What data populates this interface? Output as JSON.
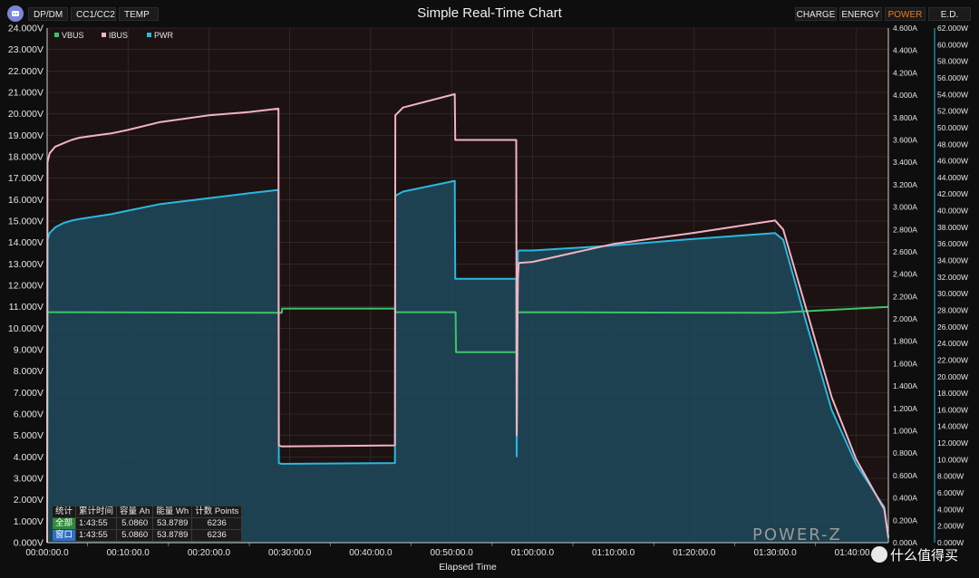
{
  "app": {
    "title": "Simple Real-Time Chart",
    "left_tabs": [
      "DP/DM",
      "CC1/CC2",
      "TEMP"
    ],
    "right_tabs": [
      "CHARGE",
      "ENERGY",
      "POWER",
      "E.D."
    ],
    "active_right_tab": "POWER",
    "watermark": "POWER-Z",
    "brand": "什么值得买"
  },
  "stats_table": {
    "headers": [
      "统计",
      "累计时间",
      "容量 Ah",
      "能量 Wh",
      "计数 Points"
    ],
    "rows": [
      [
        "全部",
        "1:43:55",
        "5.0860",
        "53.8789",
        "6236"
      ],
      [
        "窗口",
        "1:43:55",
        "5.0860",
        "53.8789",
        "6236"
      ]
    ]
  },
  "colors": {
    "vbus": "#3cc46a",
    "ibus": "#f2b3c3",
    "pwr": "#2ab8df",
    "pwr_fill": "#1d4a5c",
    "background": "#1c1212",
    "active_tab": "#f07a1e"
  },
  "chart_data": {
    "type": "line",
    "title": "Simple Real-Time Chart",
    "xlabel": "Elapsed Time",
    "x_unit": "minutes",
    "xlim": [
      0,
      104
    ],
    "x_ticks": [
      "00:00:00.0",
      "00:10:00.0",
      "00:20:00.0",
      "00:30:00.0",
      "00:40:00.0",
      "00:50:00.0",
      "01:00:00.0",
      "01:10:00.0",
      "01:20:00.0",
      "01:30:00.0",
      "01:40:00.0"
    ],
    "axes": {
      "left": {
        "unit": "V",
        "min": 0,
        "max": 24,
        "step": 1,
        "ticks": [
          "0.000V",
          "1.000V",
          "2.000V",
          "3.000V",
          "4.000V",
          "5.000V",
          "6.000V",
          "7.000V",
          "8.000V",
          "9.000V",
          "10.000V",
          "11.000V",
          "12.000V",
          "13.000V",
          "14.000V",
          "15.000V",
          "16.000V",
          "17.000V",
          "18.000V",
          "19.000V",
          "20.000V",
          "21.000V",
          "22.000V",
          "23.000V",
          "24.000V"
        ]
      },
      "right_current": {
        "unit": "A",
        "min": 0,
        "max": 4.6,
        "step": 0.2,
        "ticks": [
          "0.000A",
          "0.200A",
          "0.400A",
          "0.600A",
          "0.800A",
          "1.000A",
          "1.200A",
          "1.400A",
          "1.600A",
          "1.800A",
          "2.000A",
          "2.200A",
          "2.400A",
          "2.600A",
          "2.800A",
          "3.000A",
          "3.200A",
          "3.400A",
          "3.600A",
          "3.800A",
          "4.000A",
          "4.200A",
          "4.400A",
          "4.600A"
        ]
      },
      "right_power": {
        "unit": "W",
        "min": 0,
        "max": 62,
        "step": 2,
        "ticks": [
          "0.000W",
          "2.000W",
          "4.000W",
          "6.000W",
          "8.000W",
          "10.000W",
          "12.000W",
          "14.000W",
          "16.000W",
          "18.000W",
          "20.000W",
          "22.000W",
          "24.000W",
          "26.000W",
          "28.000W",
          "30.000W",
          "32.000W",
          "34.000W",
          "36.000W",
          "38.000W",
          "40.000W",
          "42.000W",
          "44.000W",
          "46.000W",
          "48.000W",
          "50.000W",
          "52.000W",
          "54.000W",
          "56.000W",
          "58.000W",
          "60.000W",
          "62.000W"
        ]
      }
    },
    "legend": [
      "VBUS",
      "IBUS",
      "PWR"
    ],
    "legend_position": "top-left",
    "grid": true,
    "series": [
      {
        "name": "VBUS",
        "axis": "left",
        "x": [
          0,
          0.05,
          0.2,
          29,
          29.05,
          43,
          43.05,
          50.5,
          50.55,
          58,
          58.05,
          90,
          104
        ],
        "y": [
          0,
          10.75,
          10.75,
          10.72,
          10.92,
          10.92,
          10.75,
          10.75,
          8.88,
          8.88,
          10.75,
          10.72,
          11.0
        ]
      },
      {
        "name": "IBUS",
        "axis": "right_current",
        "x": [
          0,
          0.05,
          0.3,
          1,
          2,
          3,
          4,
          6,
          8,
          10,
          14,
          20,
          25,
          28.6,
          28.65,
          29,
          43,
          43.05,
          44,
          50.4,
          50.45,
          58,
          58.05,
          58.2,
          58.3,
          60,
          70,
          80,
          90,
          91,
          94,
          97,
          100,
          103,
          103.5,
          104
        ],
        "y": [
          0,
          3.4,
          3.48,
          3.54,
          3.57,
          3.6,
          3.62,
          3.64,
          3.66,
          3.69,
          3.76,
          3.82,
          3.85,
          3.88,
          0.87,
          0.86,
          0.87,
          3.82,
          3.89,
          4.01,
          3.6,
          3.6,
          0.96,
          2.36,
          2.5,
          2.51,
          2.67,
          2.77,
          2.88,
          2.8,
          2.05,
          1.3,
          0.75,
          0.36,
          0.3,
          0.05
        ]
      },
      {
        "name": "PWR",
        "axis": "right_power",
        "x": [
          0,
          0.05,
          0.3,
          1,
          2,
          3,
          4,
          6,
          8,
          10,
          14,
          20,
          25,
          28.6,
          28.65,
          29,
          43,
          43.05,
          44,
          50.4,
          50.45,
          58,
          58.05,
          58.2,
          58.3,
          60,
          70,
          80,
          90,
          91,
          94,
          97,
          100,
          103,
          103.5,
          104
        ],
        "y": [
          0,
          36.5,
          37.3,
          38.0,
          38.5,
          38.8,
          39.0,
          39.3,
          39.6,
          40.0,
          40.8,
          41.5,
          42.1,
          42.5,
          9.6,
          9.5,
          9.6,
          41.8,
          42.3,
          43.6,
          31.8,
          31.8,
          10.4,
          35.0,
          35.2,
          35.2,
          35.8,
          36.6,
          37.3,
          36.5,
          26.0,
          16.0,
          9.5,
          5.0,
          4.3,
          0.5
        ]
      }
    ]
  }
}
